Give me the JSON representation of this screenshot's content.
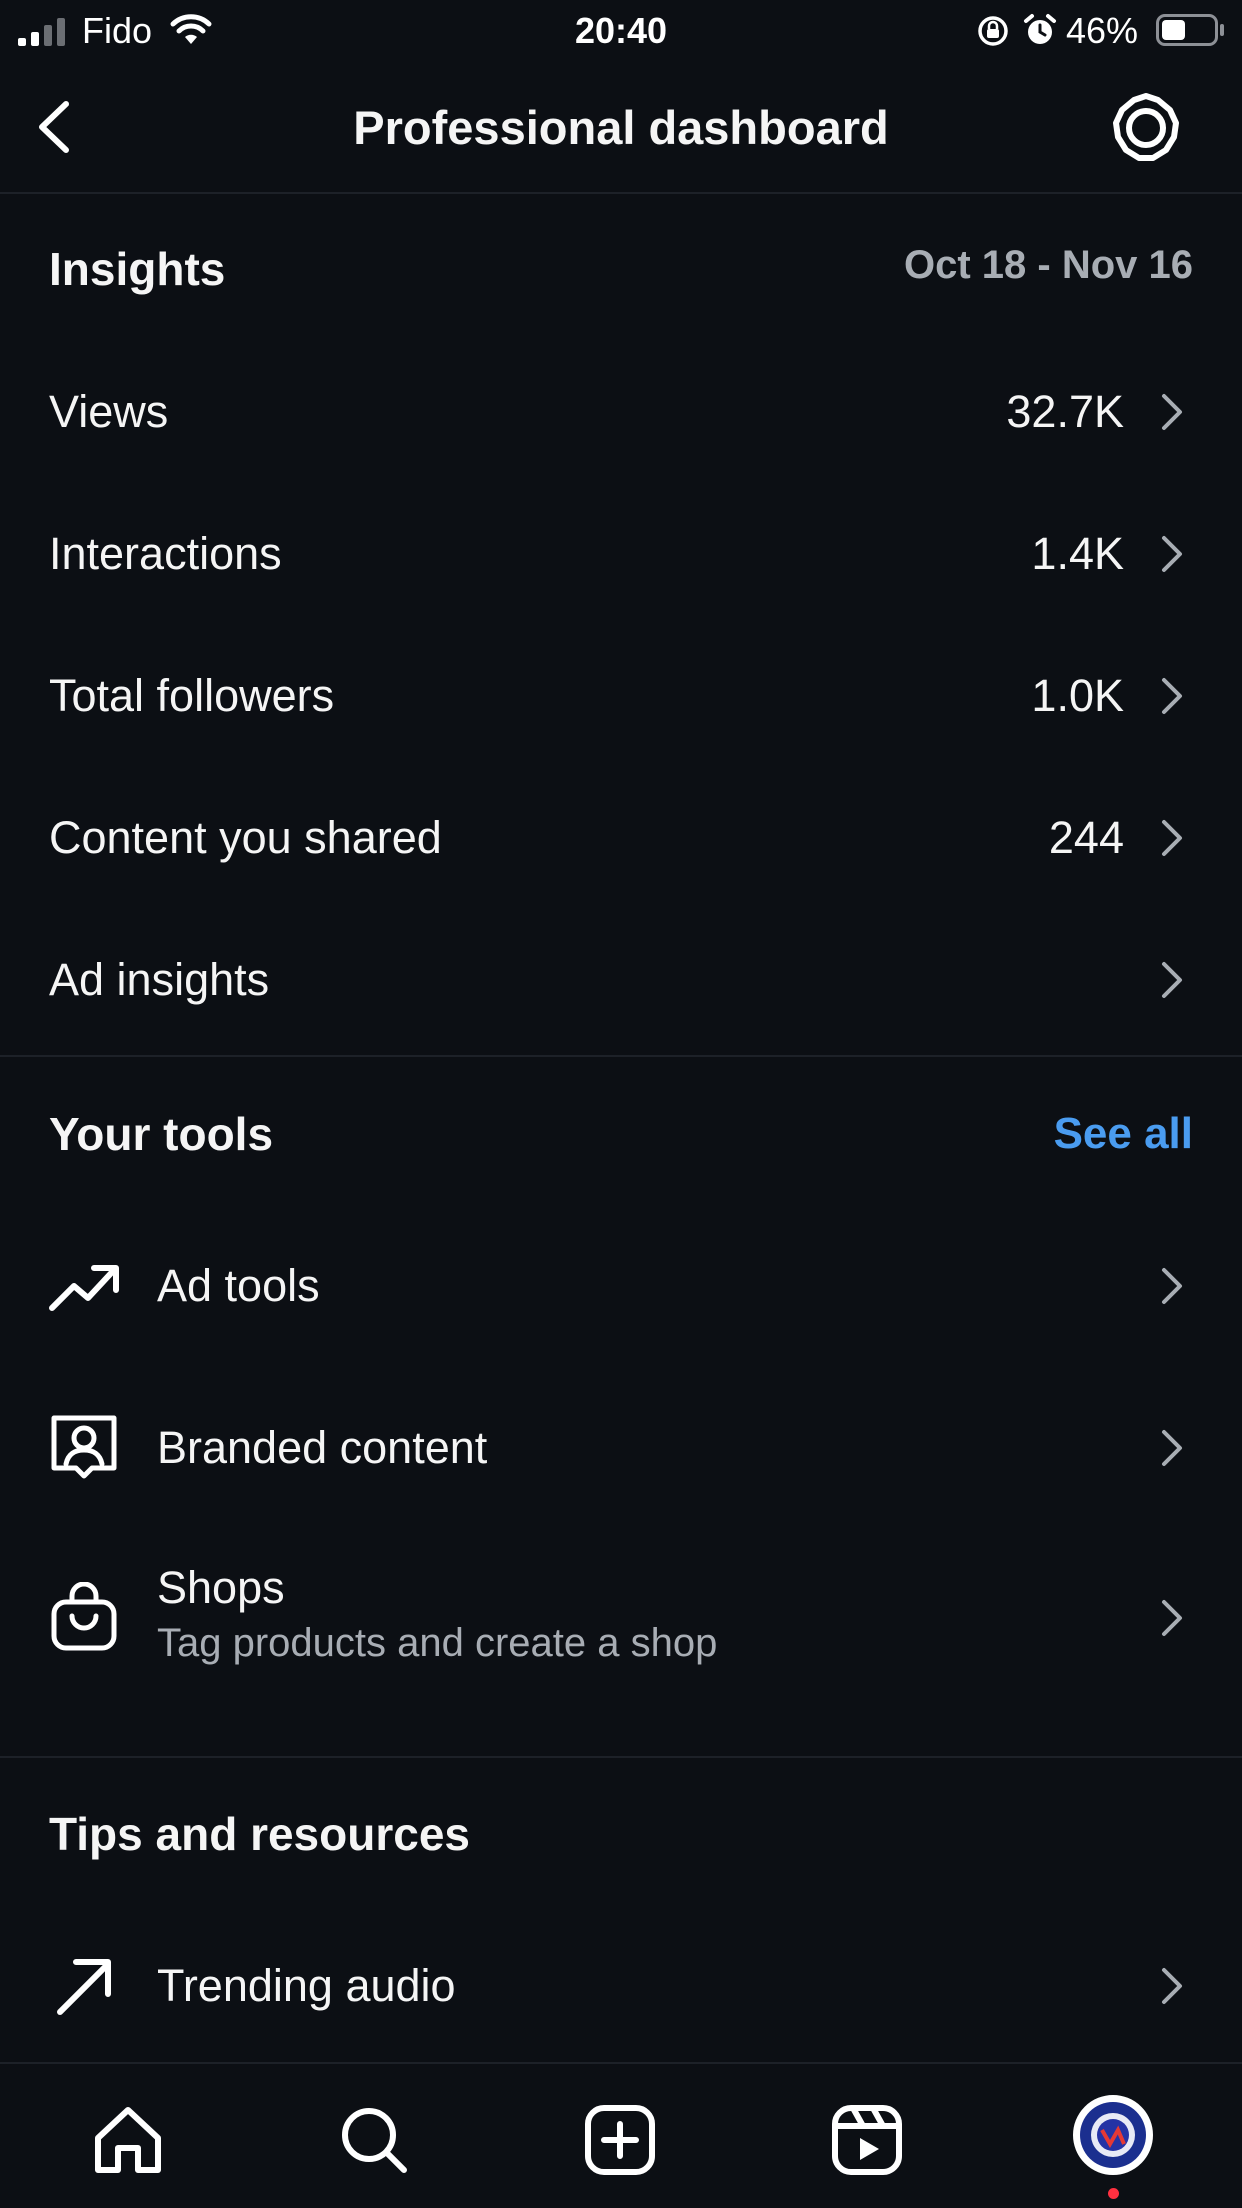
{
  "status_bar": {
    "carrier": "Fido",
    "time": "20:40",
    "battery": "46%",
    "battery_level": 0.46
  },
  "header": {
    "title": "Professional dashboard",
    "back_icon": "chevron-left-icon",
    "settings_icon": "gear-icon"
  },
  "insights": {
    "title": "Insights",
    "date_range": "Oct 18 - Nov 16",
    "rows": [
      {
        "label": "Views",
        "value": "32.7K"
      },
      {
        "label": "Interactions",
        "value": "1.4K"
      },
      {
        "label": "Total followers",
        "value": "1.0K"
      },
      {
        "label": "Content you shared",
        "value": "244"
      },
      {
        "label": "Ad insights",
        "value": ""
      }
    ]
  },
  "tools": {
    "title": "Your tools",
    "see_all": "See all",
    "items": [
      {
        "label": "Ad tools",
        "subtitle": "",
        "icon": "trending-up-icon"
      },
      {
        "label": "Branded content",
        "subtitle": "",
        "icon": "branded-content-icon"
      },
      {
        "label": "Shops",
        "subtitle": "Tag products and create a shop",
        "icon": "shopping-bag-icon"
      }
    ]
  },
  "tips": {
    "title": "Tips and resources",
    "items": [
      {
        "label": "Trending audio",
        "icon": "arrow-up-right-icon"
      }
    ]
  },
  "tab_bar": {
    "tabs": [
      "home-icon",
      "search-icon",
      "create-icon",
      "reels-icon",
      "profile-avatar"
    ],
    "accent_color": "#4a9cf0",
    "notification_color": "#ff3040"
  }
}
